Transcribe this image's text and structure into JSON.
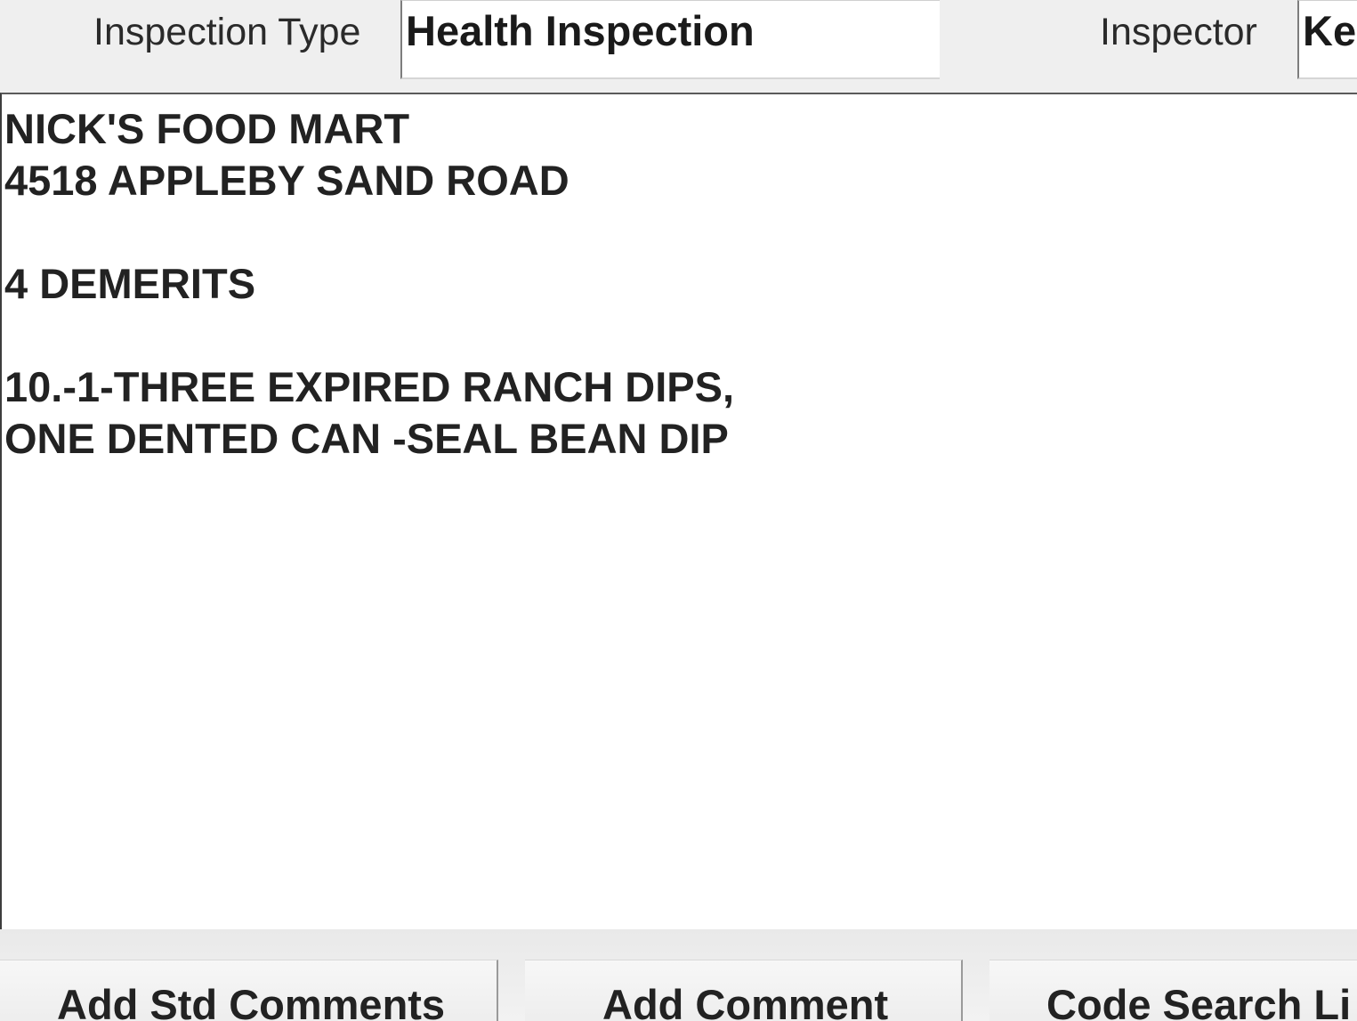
{
  "header": {
    "inspection_type_label": "Inspection Type",
    "inspection_type_value": "Health Inspection",
    "inspector_label": "Inspector",
    "inspector_value": "Ke"
  },
  "comments": {
    "lines": [
      "NICK'S FOOD MART",
      "4518 APPLEBY SAND ROAD",
      "",
      "4 DEMERITS",
      "",
      "10.-1-THREE EXPIRED RANCH DIPS,",
      "ONE DENTED CAN -SEAL BEAN DIP"
    ]
  },
  "buttons": {
    "add_std_comments": {
      "pre": "Add ",
      "mnemonic": "S",
      "post": "td Comments"
    },
    "add_comment": {
      "pre": "",
      "mnemonic": "A",
      "post": "dd Comment"
    },
    "code_search": {
      "label": "Code Search Li"
    }
  }
}
